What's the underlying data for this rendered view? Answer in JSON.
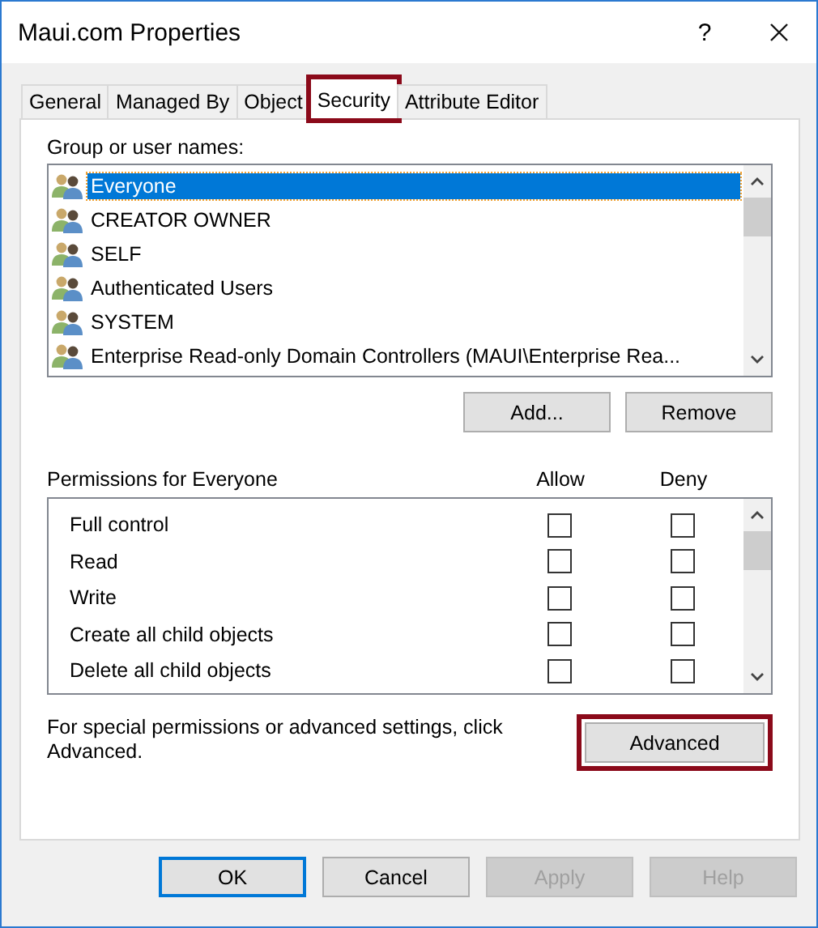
{
  "window": {
    "title": "Maui.com Properties",
    "help_glyph": "?"
  },
  "tabs": [
    {
      "label": "General",
      "selected": false,
      "highlighted": false
    },
    {
      "label": "Managed By",
      "selected": false,
      "highlighted": false
    },
    {
      "label": "Object",
      "selected": false,
      "highlighted": false
    },
    {
      "label": "Security",
      "selected": true,
      "highlighted": true
    },
    {
      "label": "Attribute Editor",
      "selected": false,
      "highlighted": false
    }
  ],
  "groups": {
    "label": "Group or user names:",
    "items": [
      {
        "name": "Everyone",
        "selected": true
      },
      {
        "name": "CREATOR OWNER",
        "selected": false
      },
      {
        "name": "SELF",
        "selected": false
      },
      {
        "name": "Authenticated Users",
        "selected": false
      },
      {
        "name": "SYSTEM",
        "selected": false
      },
      {
        "name": "Enterprise Read-only Domain Controllers (MAUI\\Enterprise Rea...",
        "selected": false
      }
    ],
    "buttons": [
      {
        "label": "Add..."
      },
      {
        "label": "Remove"
      }
    ]
  },
  "permissions": {
    "label": "Permissions for Everyone",
    "allow_header": "Allow",
    "deny_header": "Deny",
    "rows": [
      {
        "name": "Full control",
        "allow": false,
        "deny": false
      },
      {
        "name": "Read",
        "allow": false,
        "deny": false
      },
      {
        "name": "Write",
        "allow": false,
        "deny": false
      },
      {
        "name": "Create all child objects",
        "allow": false,
        "deny": false
      },
      {
        "name": "Delete all child objects",
        "allow": false,
        "deny": false
      }
    ]
  },
  "advanced": {
    "text": "For special permissions or advanced settings, click Advanced.",
    "button": {
      "label": "Advanced",
      "highlighted": true
    }
  },
  "footer_buttons": [
    {
      "label": "OK",
      "default": true,
      "disabled": false
    },
    {
      "label": "Cancel",
      "default": false,
      "disabled": false
    },
    {
      "label": "Apply",
      "default": false,
      "disabled": true
    },
    {
      "label": "Help",
      "default": false,
      "disabled": true
    }
  ]
}
